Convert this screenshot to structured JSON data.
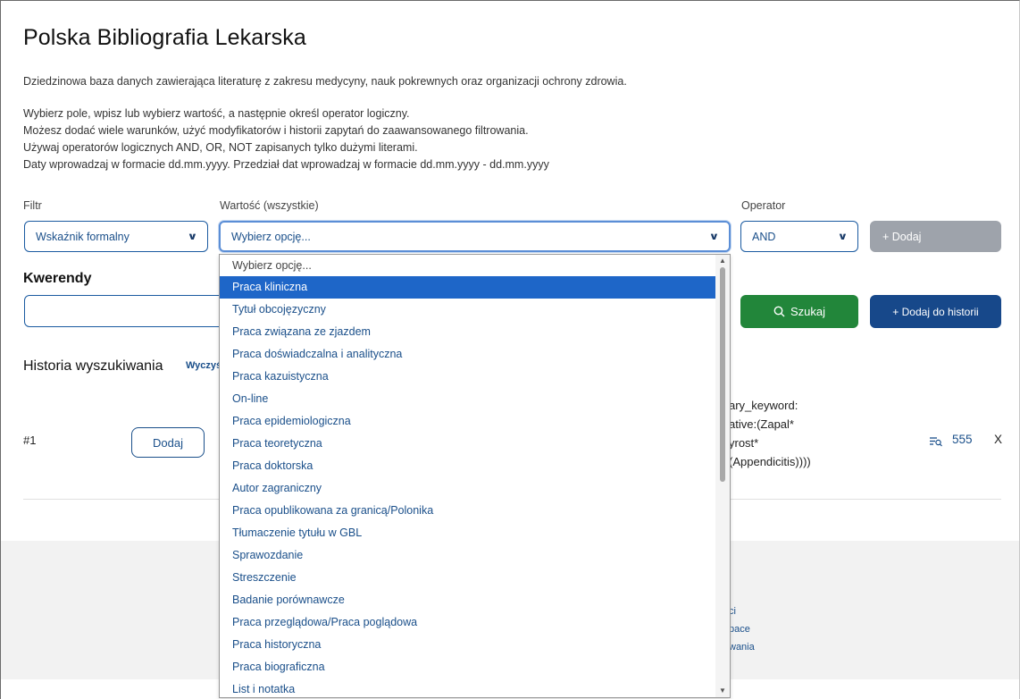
{
  "page": {
    "title": "Polska Bibliografia Lekarska",
    "description": "Dziedzinowa baza danych zawierająca literaturę z zakresu medycyny, nauk pokrewnych oraz organizacji ochrony zdrowia.",
    "instructions": [
      "Wybierz pole, wpisz lub wybierz wartość, a następnie określ operator logiczny.",
      "Możesz dodać wiele warunków, użyć modyfikatorów i historii zapytań do zaawansowanego filtrowania.",
      "Używaj operatorów logicznych AND, OR, NOT zapisanych tylko dużymi literami.",
      "Daty wprowadzaj w formacie dd.mm.yyyy. Przedział dat wprowadzaj w formacie dd.mm.yyyy - dd.mm.yyyy"
    ]
  },
  "filter_row": {
    "filter_label": "Filtr",
    "filter_value": "Wskaźnik formalny",
    "value_label": "Wartość (wszystkie)",
    "value_value": "Wybierz opcję...",
    "operator_label": "Operator",
    "operator_value": "AND",
    "add_button": "+ Dodaj"
  },
  "queries": {
    "title": "Kwerendy",
    "input_value": "",
    "search_button": "Szukaj",
    "add_history_button": "+ Dodaj do historii"
  },
  "history": {
    "title": "Historia wyszukiwania",
    "clear_link": "Wyczyś",
    "rows": [
      {
        "number": "#1",
        "add_button": "Dodaj",
        "query_lines": [
          "ary_keyword:",
          "ative:(Zapal*",
          "yrost*",
          "(Appendicitis))))"
        ],
        "count": "555",
        "remove": "X"
      }
    ]
  },
  "footer": {
    "links": [
      "ci",
      "pace",
      "wania"
    ]
  },
  "dropdown": {
    "options": [
      "Wybierz opcję...",
      "Praca kliniczna",
      "Tytuł obcojęzyczny",
      "Praca związana ze zjazdem",
      "Praca doświadczalna i analityczna",
      "Praca kazuistyczna",
      "On-line",
      "Praca epidemiologiczna",
      "Praca teoretyczna",
      "Praca doktorska",
      "Autor zagraniczny",
      "Praca opublikowana za granicą/Polonika",
      "Tłumaczenie tytułu w GBL",
      "Sprawozdanie",
      "Streszczenie",
      "Badanie porównawcze",
      "Praca przeglądowa/Praca poglądowa",
      "Praca historyczna",
      "Praca biograficzna",
      "List i notatka"
    ],
    "highlighted": "Praca kliniczna"
  },
  "icons": {
    "chevron": "chevron-down-icon",
    "search": "search-icon",
    "count": "filter-search-icon"
  },
  "colors": {
    "primary_blue": "#17488a",
    "link_blue": "#1a4f8a",
    "highlight_blue": "#1e66c8",
    "search_green": "#22863a",
    "disabled_grey": "#9ea3ab"
  }
}
